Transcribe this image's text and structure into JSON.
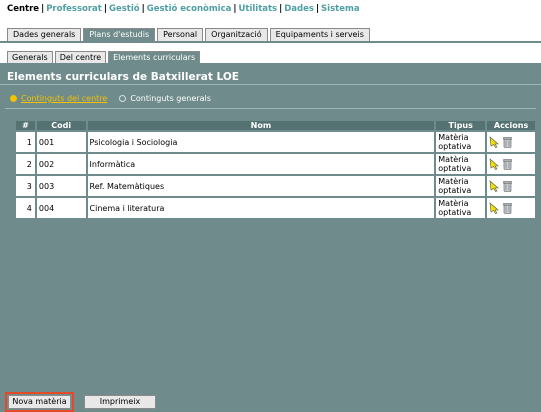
{
  "topmenu": {
    "items": [
      {
        "label": "Centre"
      },
      {
        "label": "Professorat"
      },
      {
        "label": "Gestió"
      },
      {
        "label": "Gestió econòmica"
      },
      {
        "label": "Utilitats"
      },
      {
        "label": "Dades"
      },
      {
        "label": "Sistema"
      }
    ]
  },
  "tabs1": [
    "Dades generals",
    "Plans d'estudis",
    "Personal",
    "Organització",
    "Equipaments i serveis"
  ],
  "tabs2": [
    "Generals",
    "Del centre",
    "Elements curriculars"
  ],
  "panel": {
    "title": "Elements curriculars de Batxillerat LOE",
    "radio_on": "Continguts del centre",
    "radio_off": "Continguts generals"
  },
  "table": {
    "headers": [
      "#",
      "Codi",
      "Nom",
      "Tipus",
      "Accions"
    ],
    "rows": [
      {
        "num": "1",
        "codi": "001",
        "nom": "Psicologia i Sociologia",
        "tipus1": "Matèria",
        "tipus2": "optativa"
      },
      {
        "num": "2",
        "codi": "002",
        "nom": "Informàtica",
        "tipus1": "Matèria",
        "tipus2": "optativa"
      },
      {
        "num": "3",
        "codi": "003",
        "nom": "Ref. Matemàtiques",
        "tipus1": "Matèria",
        "tipus2": "optativa"
      },
      {
        "num": "4",
        "codi": "004",
        "nom": "Cinema i literatura",
        "tipus1": "Matèria",
        "tipus2": "optativa"
      }
    ],
    "action_icons": [
      "edit-icon",
      "delete-icon"
    ]
  },
  "buttons": {
    "nova": "Nova matèria",
    "imprimeix": "Imprimeix"
  },
  "colors": {
    "panel": "#6f8b8b",
    "header": "#557272",
    "accent_yellow": "#f2c200",
    "menu_link": "#4f9fa2",
    "highlight": "#e24a2a"
  }
}
